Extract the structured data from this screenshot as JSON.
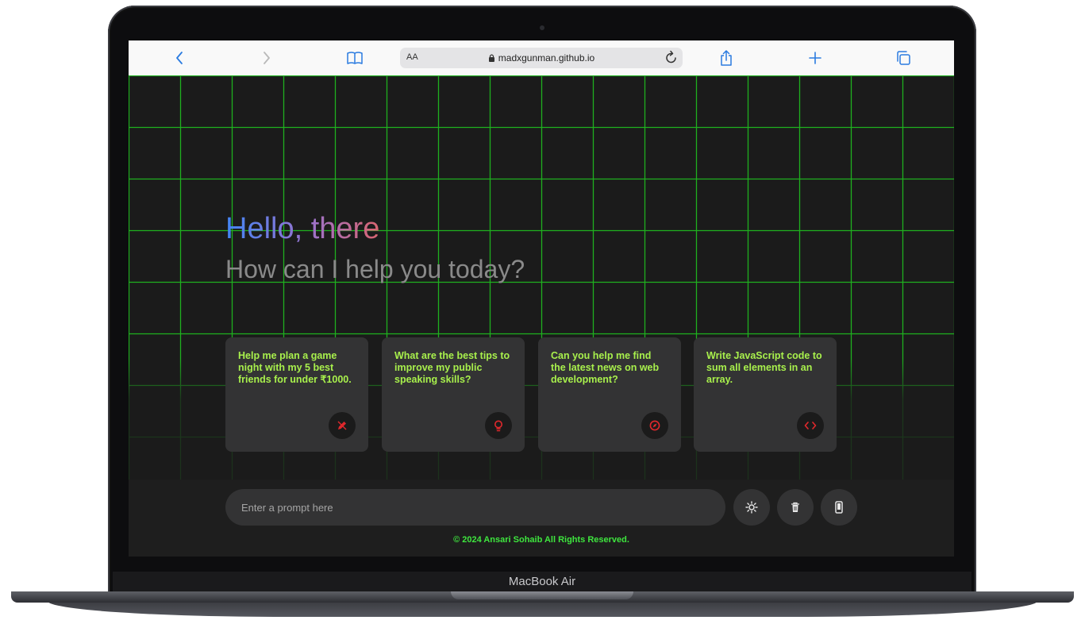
{
  "device": {
    "brand": "MacBook Air"
  },
  "browser": {
    "back_icon": "chevron-left-icon",
    "forward_icon": "chevron-right-icon",
    "reader_icon": "book-icon",
    "text_size": "AA",
    "url": "madxgunman.github.io",
    "reload_icon": "reload-icon",
    "share_icon": "share-icon",
    "new_tab_icon": "plus-icon",
    "tabs_icon": "tabs-icon"
  },
  "hero": {
    "greeting": "Hello, there",
    "subtitle": "How can I help you today?"
  },
  "suggestions": [
    {
      "text": "Help me plan a game night with my 5 best friends for under ₹1000.",
      "icon": "pencil-icon"
    },
    {
      "text": "What are the best tips to improve my public speaking skills?",
      "icon": "lightbulb-icon"
    },
    {
      "text": "Can you help me find the latest news on web development?",
      "icon": "compass-icon"
    },
    {
      "text": "Write JavaScript code to sum all elements in an array.",
      "icon": "code-icon"
    }
  ],
  "prompt": {
    "placeholder": "Enter a prompt here",
    "value": ""
  },
  "actions": {
    "theme_icon": "sun-icon",
    "delete_icon": "trash-icon",
    "device_icon": "phone-icon"
  },
  "footer": {
    "text": "© 2024 Ansari Sohaib All Rights Reserved."
  },
  "colors": {
    "accent": "#3ee63e",
    "card_text": "#a8f04c",
    "icon_red": "#e0282c",
    "grid": "#1fb01f",
    "background": "#1b1b1b"
  }
}
